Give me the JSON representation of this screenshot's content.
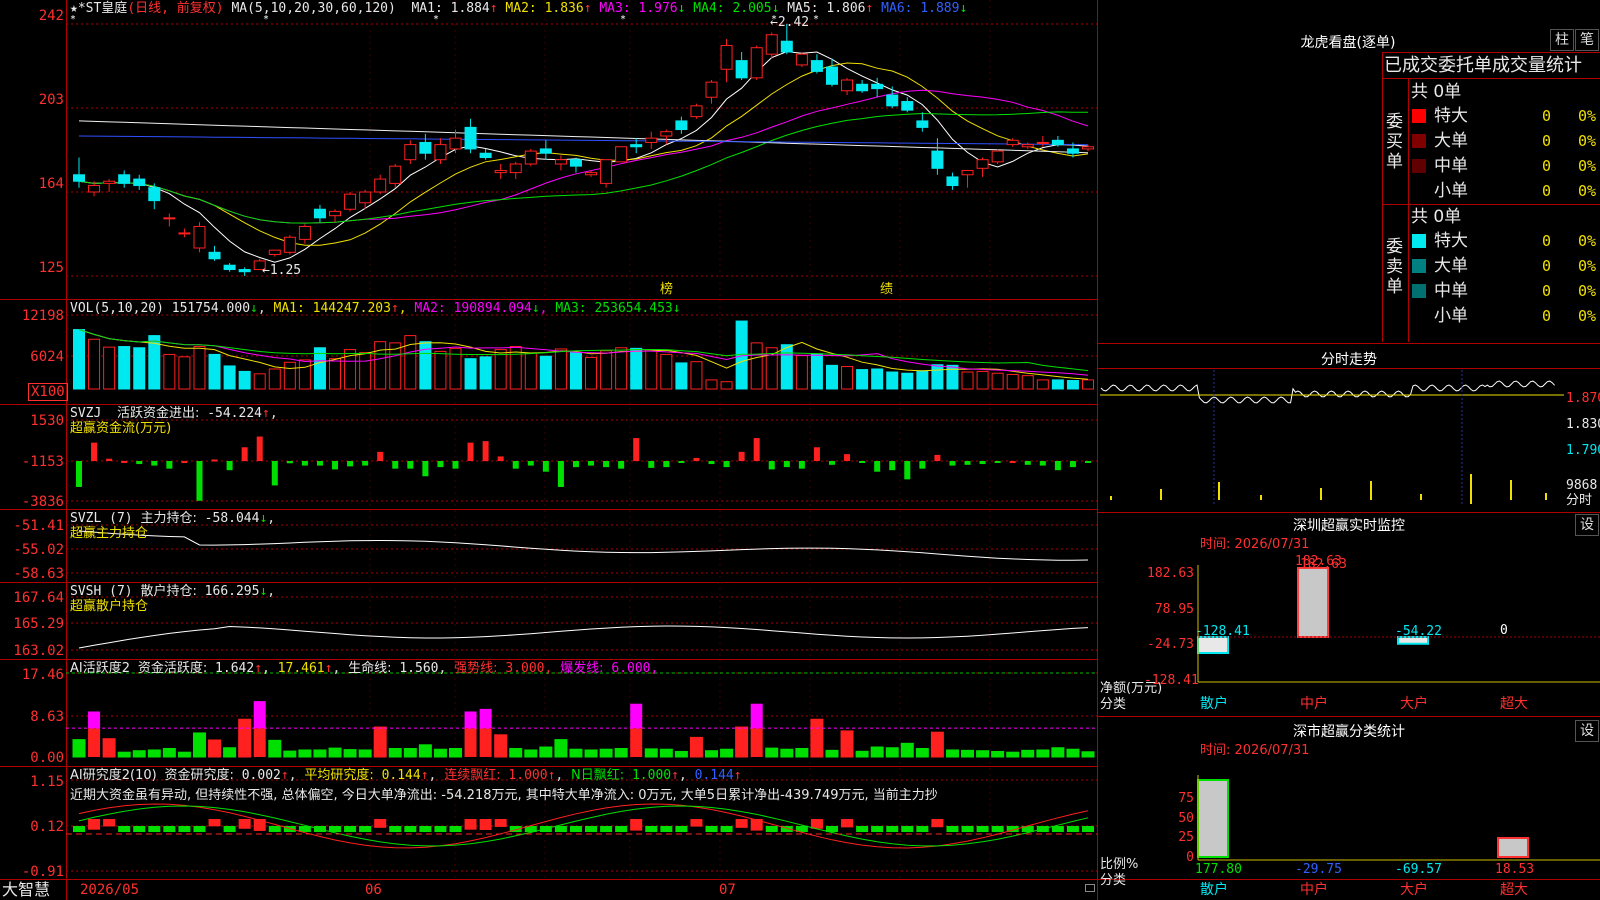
{
  "colors": {
    "up": "#ff2020",
    "down": "#00e8f0",
    "ma1": "#ffffff",
    "ma2": "#f0e000",
    "ma3": "#ff00ff",
    "ma4": "#00e000",
    "ma5": "#f0f0f0",
    "ma6": "#3050ff",
    "grid": "#b00000"
  },
  "main": {
    "title": "★*ST皇庭",
    "period": "(日线, 前复权)",
    "ma_label": "MA(5,10,20,30,60,120)",
    "ma": [
      {
        "label": "MA1:",
        "value": "1.884",
        "arrow": "↑"
      },
      {
        "label": "MA2:",
        "value": "1.836",
        "arrow": "↑"
      },
      {
        "label": "MA3:",
        "value": "1.976",
        "arrow": "↓"
      },
      {
        "label": "MA4:",
        "value": "2.005",
        "arrow": "↓"
      },
      {
        "label": "MA5:",
        "value": "1.806",
        "arrow": "↑"
      },
      {
        "label": "MA6:",
        "value": "1.889",
        "arrow": "↓"
      }
    ],
    "axis": [
      "242",
      "203",
      "164",
      "125"
    ],
    "high_label": "2.42",
    "low_label": "1.25",
    "markers": [
      "榜",
      "绩"
    ]
  },
  "vol": {
    "title": "VOL(5,10,20)",
    "value": "151754.000",
    "ma": [
      {
        "label": "MA1:",
        "value": "144247.203",
        "arrow": "↑"
      },
      {
        "label": "MA2:",
        "value": "190894.094",
        "arrow": "↓"
      },
      {
        "label": "MA3:",
        "value": "253654.453",
        "arrow": "↓"
      }
    ],
    "axis": [
      "12198",
      "6024"
    ],
    "unit": "X100"
  },
  "svzj": {
    "title": "SVZJ",
    "label": "活跃资金进出:",
    "value": "-54.224",
    "arrow": "↑",
    "sub": "超赢资金流(万元)",
    "axis": [
      "1530",
      "-1153",
      "-3836"
    ]
  },
  "svzl": {
    "title": "SVZL (7)",
    "label": "主力持仓:",
    "value": "-58.044",
    "arrow": "↓",
    "sub": "超赢主力持仓",
    "axis": [
      "-51.41",
      "-55.02",
      "-58.63"
    ]
  },
  "svsh": {
    "title": "SVSH (7)",
    "label": "散户持仓:",
    "value": "166.295",
    "arrow": "↓",
    "sub": "超赢散户持仓",
    "axis": [
      "167.64",
      "165.29",
      "163.02"
    ]
  },
  "ai1": {
    "title": "AI活跃度2",
    "label": "资金活跃度:",
    "value": "1.642",
    "arrow": "↑",
    "v2": "17.461",
    "label3": "生命线:",
    "v3": "1.560",
    "label4": "强势线:",
    "v4": "3.000",
    "label5": "爆发线:",
    "v5": "6.000",
    "axis": [
      "17.46",
      "8.63",
      "0.00"
    ]
  },
  "ai2": {
    "title": "AI研究度2(10)",
    "label": "资金研究度:",
    "value": "0.002",
    "arrow": "↑",
    "label2": "平均研究度:",
    "v2": "0.144",
    "label3": "连续飘红:",
    "v3": "1.000",
    "label4": "N日飘红:",
    "v4": "1.000",
    "v5": "0.144",
    "comment": "近期大资金虽有异动, 但持续性不强, 总体偏空, 今日大单净流出: -54.218万元, 其中特大单净流入: 0万元, 大单5日累计净出-439.749万元, 当前主力抄",
    "axis": [
      "1.15",
      "0.12",
      "-0.91"
    ]
  },
  "bottom": {
    "brand": "大智慧",
    "dates": [
      "2026/05",
      "06",
      "07"
    ]
  },
  "right": {
    "lhb_title": "龙虎看盘(逐单)",
    "btn1": "柱",
    "btn2": "笔",
    "table_header": "已成交委托单成交量统计",
    "buy_side": "委买单",
    "sell_side": "委卖单",
    "buy_total": "共 0单",
    "sell_total": "共 0单",
    "rows": [
      "特大",
      "大单",
      "中单",
      "小单"
    ],
    "row_values": [
      "0",
      "0%"
    ],
    "fs_title": "分时走势",
    "fs_axis": [
      "1.870",
      "1.830",
      "1.790"
    ],
    "fs_vol": "9868",
    "fs_unit": "分时",
    "sz_title": "深圳超赢实时监控",
    "sz_time": "时间: 2026/07/31",
    "sz_axis": [
      "182.63",
      "78.95",
      "-24.73",
      "-128.41"
    ],
    "sz_bars": [
      {
        "cat": "散户",
        "value": -128.41
      },
      {
        "cat": "中户",
        "value": 182.63
      },
      {
        "cat": "大户",
        "value": -54.22
      },
      {
        "cat": "超大",
        "value": 0
      }
    ],
    "sz_top": "182.63",
    "sz_ylabel": "净额(万元)",
    "sz_xlabel": "分类",
    "set": "设",
    "ss_title": "深市超赢分类统计",
    "ss_time": "时间: 2026/07/31",
    "ss_axis": [
      "75",
      "50",
      "25",
      "0"
    ],
    "ss_bars": [
      {
        "cat": "散户",
        "value": 177.8
      },
      {
        "cat": "中户",
        "value": -29.75
      },
      {
        "cat": "大户",
        "value": -69.57
      },
      {
        "cat": "超大",
        "value": 18.53
      }
    ],
    "ss_ylabel": "比例%",
    "ss_xlabel": "分类"
  },
  "chart_data": {
    "type": "candlestick",
    "title": "★*ST皇庭",
    "x_start": "2026/05",
    "ylim": [
      1.25,
      2.42
    ],
    "candles": [
      [
        1.72,
        1.8,
        1.66,
        1.69
      ],
      [
        1.64,
        1.69,
        1.62,
        1.67
      ],
      [
        1.68,
        1.7,
        1.64,
        1.69
      ],
      [
        1.72,
        1.74,
        1.66,
        1.68
      ],
      [
        1.7,
        1.72,
        1.65,
        1.67
      ],
      [
        1.66,
        1.68,
        1.56,
        1.6
      ],
      [
        1.52,
        1.54,
        1.48,
        1.52
      ],
      [
        1.45,
        1.47,
        1.43,
        1.45
      ],
      [
        1.38,
        1.5,
        1.36,
        1.48
      ],
      [
        1.36,
        1.39,
        1.32,
        1.33
      ],
      [
        1.3,
        1.31,
        1.27,
        1.28
      ],
      [
        1.28,
        1.29,
        1.25,
        1.27
      ],
      [
        1.28,
        1.33,
        1.28,
        1.32
      ],
      [
        1.35,
        1.37,
        1.34,
        1.37
      ],
      [
        1.36,
        1.44,
        1.35,
        1.43
      ],
      [
        1.42,
        1.49,
        1.4,
        1.48
      ],
      [
        1.56,
        1.58,
        1.5,
        1.52
      ],
      [
        1.53,
        1.56,
        1.5,
        1.55
      ],
      [
        1.56,
        1.64,
        1.55,
        1.63
      ],
      [
        1.59,
        1.65,
        1.56,
        1.64
      ],
      [
        1.64,
        1.72,
        1.63,
        1.7
      ],
      [
        1.68,
        1.77,
        1.66,
        1.76
      ],
      [
        1.79,
        1.88,
        1.77,
        1.86
      ],
      [
        1.87,
        1.91,
        1.79,
        1.82
      ],
      [
        1.79,
        1.89,
        1.77,
        1.86
      ],
      [
        1.84,
        1.93,
        1.82,
        1.89
      ],
      [
        1.94,
        1.98,
        1.82,
        1.84
      ],
      [
        1.82,
        1.84,
        1.79,
        1.8
      ],
      [
        1.73,
        1.77,
        1.7,
        1.74
      ],
      [
        1.73,
        1.78,
        1.7,
        1.77
      ],
      [
        1.77,
        1.84,
        1.76,
        1.83
      ],
      [
        1.84,
        1.88,
        1.79,
        1.82
      ],
      [
        1.77,
        1.81,
        1.74,
        1.79
      ],
      [
        1.79,
        1.8,
        1.73,
        1.76
      ],
      [
        1.72,
        1.74,
        1.71,
        1.73
      ],
      [
        1.68,
        1.79,
        1.66,
        1.79
      ],
      [
        1.78,
        1.85,
        1.78,
        1.85
      ],
      [
        1.86,
        1.89,
        1.82,
        1.85
      ],
      [
        1.87,
        1.92,
        1.84,
        1.89
      ],
      [
        1.9,
        1.93,
        1.86,
        1.92
      ],
      [
        1.97,
        1.99,
        1.91,
        1.93
      ],
      [
        1.99,
        2.05,
        1.98,
        2.04
      ],
      [
        2.08,
        2.16,
        2.05,
        2.15
      ],
      [
        2.21,
        2.35,
        2.15,
        2.32
      ],
      [
        2.25,
        2.29,
        2.16,
        2.17
      ],
      [
        2.17,
        2.32,
        2.16,
        2.31
      ],
      [
        2.28,
        2.38,
        2.26,
        2.37
      ],
      [
        2.34,
        2.42,
        2.28,
        2.29
      ],
      [
        2.23,
        2.29,
        2.22,
        2.28
      ],
      [
        2.25,
        2.28,
        2.19,
        2.2
      ],
      [
        2.22,
        2.26,
        2.13,
        2.14
      ],
      [
        2.11,
        2.17,
        2.09,
        2.16
      ],
      [
        2.14,
        2.16,
        2.1,
        2.11
      ],
      [
        2.14,
        2.17,
        2.08,
        2.12
      ],
      [
        2.09,
        2.13,
        2.03,
        2.04
      ],
      [
        2.06,
        2.08,
        2.01,
        2.02
      ],
      [
        1.97,
        2.01,
        1.92,
        1.94
      ],
      [
        1.83,
        1.89,
        1.72,
        1.75
      ],
      [
        1.71,
        1.73,
        1.65,
        1.67
      ],
      [
        1.72,
        1.74,
        1.66,
        1.74
      ],
      [
        1.75,
        1.8,
        1.71,
        1.79
      ],
      [
        1.78,
        1.84,
        1.77,
        1.83
      ],
      [
        1.86,
        1.89,
        1.85,
        1.88
      ],
      [
        1.85,
        1.87,
        1.84,
        1.86
      ],
      [
        1.87,
        1.9,
        1.85,
        1.87
      ],
      [
        1.88,
        1.9,
        1.85,
        1.86
      ],
      [
        1.84,
        1.87,
        1.8,
        1.82
      ],
      [
        1.84,
        1.86,
        1.83,
        1.85
      ]
    ],
    "volume": [
      9800,
      8200,
      6900,
      7000,
      6800,
      8800,
      5700,
      5300,
      7000,
      5700,
      3800,
      2900,
      2500,
      3300,
      4400,
      4800,
      6800,
      5000,
      6500,
      6000,
      7800,
      7600,
      8800,
      7800,
      6200,
      6700,
      5000,
      5300,
      6500,
      7000,
      5900,
      5400,
      6600,
      6000,
      5200,
      6300,
      6800,
      6700,
      6500,
      5700,
      4300,
      4500,
      1500,
      1200,
      11200,
      7600,
      6800,
      7300,
      5500,
      5800,
      3900,
      3700,
      3200,
      3300,
      2800,
      2600,
      3000,
      4000,
      3900,
      2800,
      2900,
      2600,
      2400,
      2200,
      1500,
      1500,
      1400,
      1500
    ],
    "flow": [
      -1700,
      1200,
      150,
      0,
      -200,
      -300,
      -500,
      0,
      -2600,
      100,
      -600,
      900,
      1600,
      -1600,
      -150,
      -300,
      -300,
      -550,
      -350,
      -300,
      600,
      -500,
      -500,
      -1000,
      -400,
      -500,
      1200,
      1300,
      300,
      -500,
      -300,
      -700,
      -1700,
      -400,
      -300,
      -400,
      -500,
      1500,
      -450,
      -400,
      -100,
      200,
      -200,
      -400,
      600,
      1500,
      -550,
      -400,
      -500,
      900,
      -250,
      450,
      -120,
      -700,
      -600,
      -1200,
      -500,
      400,
      -300,
      -250,
      -200,
      -100,
      0,
      -250,
      -300,
      -600,
      -400,
      -54
    ]
  }
}
